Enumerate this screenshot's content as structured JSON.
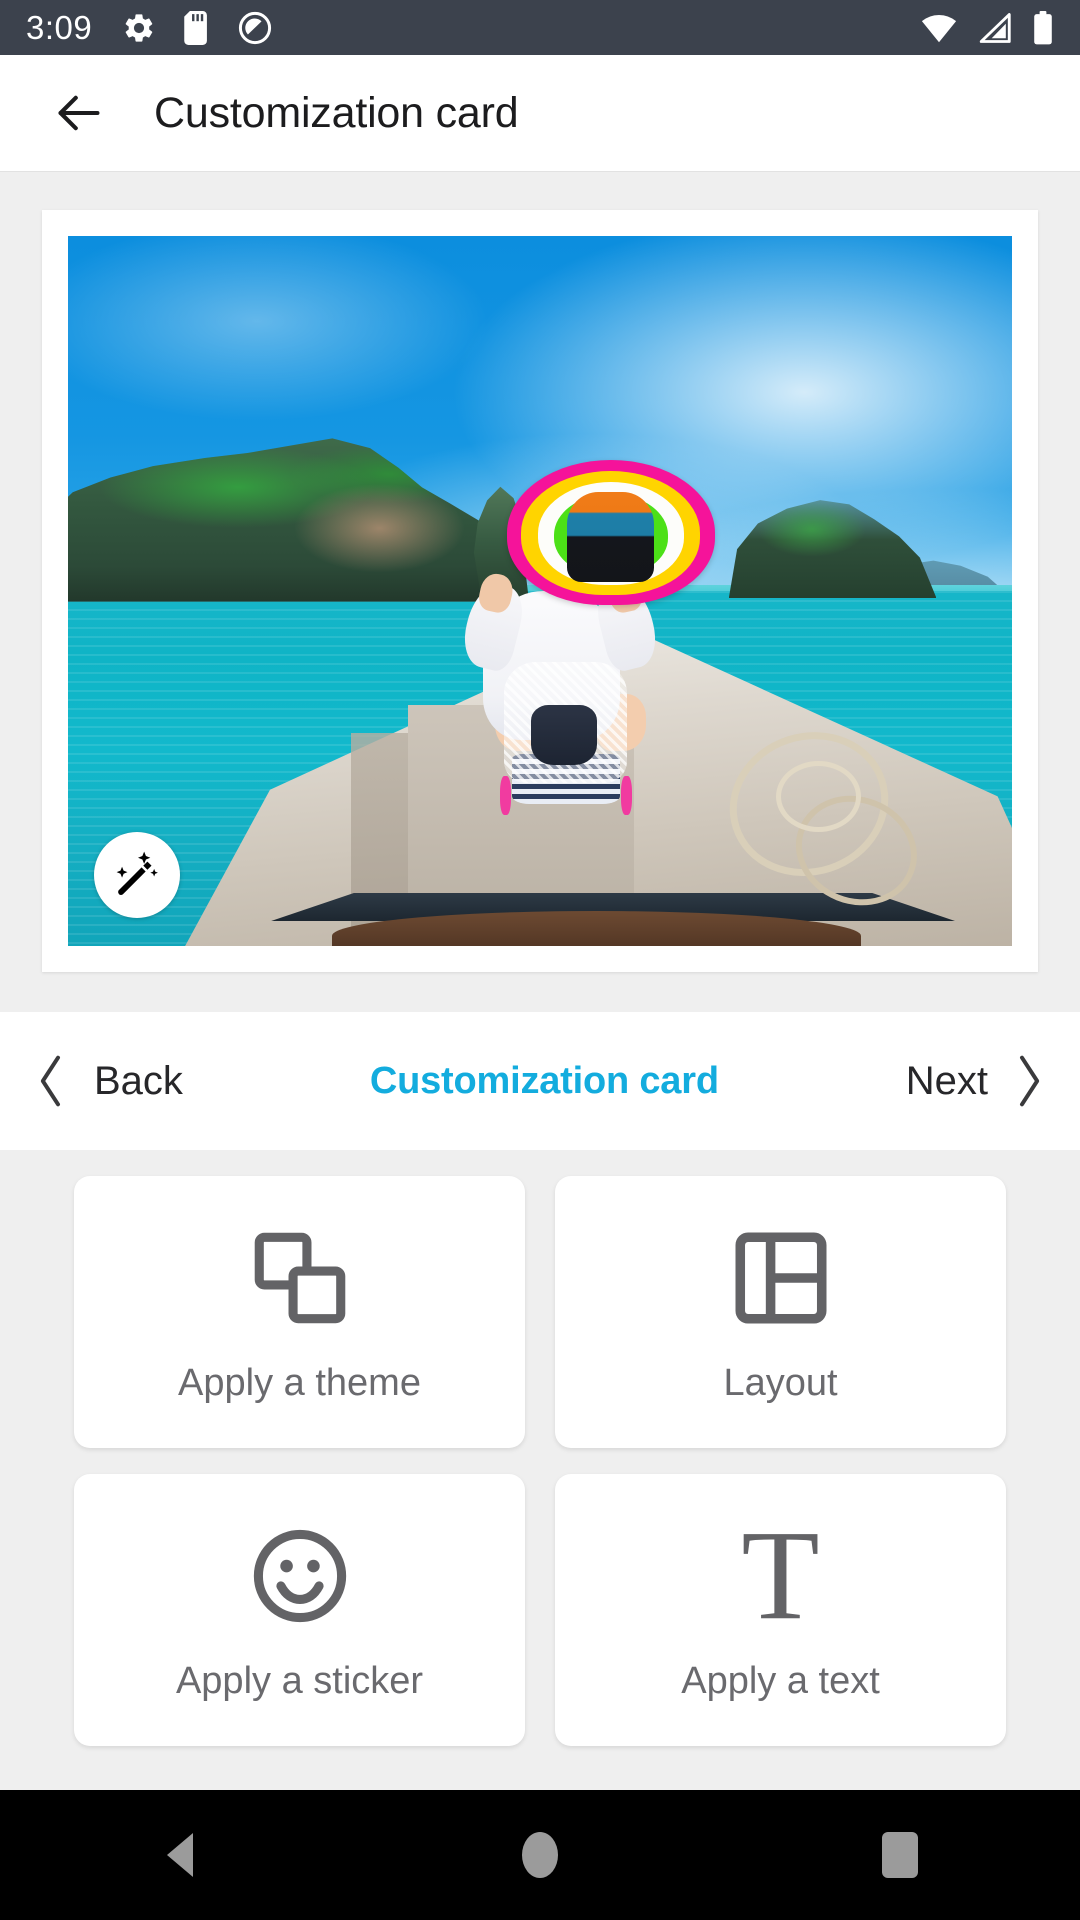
{
  "status_bar": {
    "time": "3:09",
    "left_icons": [
      "gear-icon",
      "sd-card-icon",
      "do-not-disturb-icon"
    ],
    "right_icons": [
      "wifi-icon",
      "cellular-signal-icon",
      "battery-icon"
    ],
    "background_color": "#3C424D",
    "foreground_color": "#FFFFFF"
  },
  "app_bar": {
    "back_icon": "arrow-left-icon",
    "title": "Customization card",
    "background_color": "#FFFFFF",
    "title_color": "#1C1C1E"
  },
  "preview": {
    "photo_alt": "Woman in colorful wide-brim straw hat sitting on bow of longtail boat on turquoise sea with limestone cliffs",
    "magic_wand_icon": "magic-wand-icon",
    "card_background": "#FFFFFF"
  },
  "step_nav": {
    "back_label": "Back",
    "back_icon": "chevron-left-icon",
    "title": "Customization card",
    "title_color": "#13ACDE",
    "next_label": "Next",
    "next_icon": "chevron-right-icon"
  },
  "options": [
    {
      "label": "Apply a theme",
      "icon": "overlapping-squares-icon"
    },
    {
      "label": "Layout",
      "icon": "layout-grid-icon"
    },
    {
      "label": "Apply a sticker",
      "icon": "smiley-face-icon"
    },
    {
      "label": "Apply a text",
      "icon": "text-t-icon",
      "glyph": "T"
    }
  ],
  "android_nav": {
    "back_icon": "nav-back-triangle-icon",
    "home_icon": "nav-home-circle-icon",
    "recents_icon": "nav-recents-square-icon",
    "background_color": "#000000"
  },
  "theme": {
    "page_background": "#EFEFEF",
    "accent": "#13ACDE",
    "icon_gray": "#636366",
    "label_gray": "#6A6A6E"
  }
}
